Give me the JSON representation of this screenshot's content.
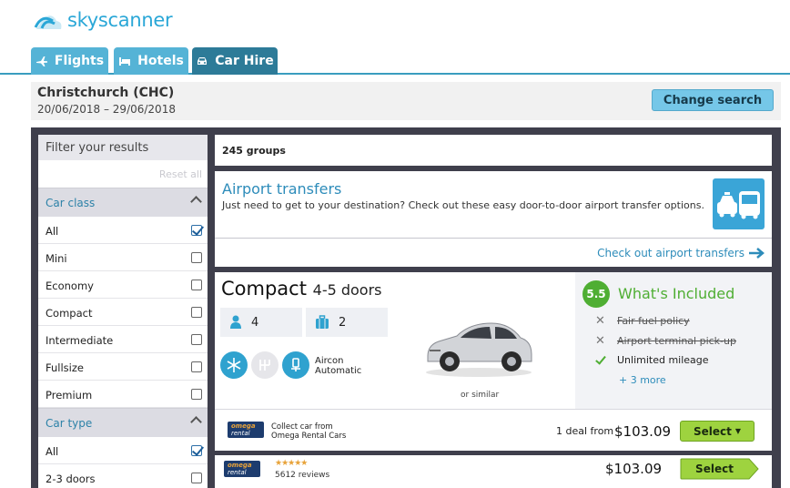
{
  "brand": {
    "name": "skyscanner",
    "color": "#2aa7d7"
  },
  "tabs": [
    {
      "label": "Flights",
      "icon": "plane-icon"
    },
    {
      "label": "Hotels",
      "icon": "bed-icon"
    },
    {
      "label": "Car Hire",
      "icon": "car-icon",
      "active": true
    }
  ],
  "search": {
    "location": "Christchurch (CHC)",
    "dates": "20/06/2018 – 29/06/2018",
    "change_label": "Change search"
  },
  "filters": {
    "title": "Filter your results",
    "reset_label": "Reset all",
    "car_class": {
      "heading": "Car class",
      "options": [
        {
          "label": "All",
          "checked": true
        },
        {
          "label": "Mini",
          "checked": false
        },
        {
          "label": "Economy",
          "checked": false
        },
        {
          "label": "Compact",
          "checked": false
        },
        {
          "label": "Intermediate",
          "checked": false
        },
        {
          "label": "Fullsize",
          "checked": false
        },
        {
          "label": "Premium",
          "checked": false
        }
      ]
    },
    "car_type": {
      "heading": "Car type",
      "options": [
        {
          "label": "All",
          "checked": true
        },
        {
          "label": "2-3 doors",
          "checked": false
        }
      ]
    }
  },
  "results": {
    "groups_count": "245 groups",
    "airport_transfers": {
      "title": "Airport transfers",
      "description": "Just need to get to your destination? Check out these easy door-to-door airport transfer options.",
      "link_label": "Check out airport transfers"
    },
    "car": {
      "class": "Compact",
      "doors": "4-5 doors",
      "seats": "4",
      "bags": "2",
      "feature_line1": "Aircon",
      "feature_line2": "Automatic",
      "similar_label": "or similar",
      "included": {
        "score": "5.5",
        "title": "What's Included",
        "items": [
          {
            "label": "Fair fuel policy",
            "included": false
          },
          {
            "label": "Airport terminal pick-up",
            "included": false
          },
          {
            "label": "Unlimited mileage",
            "included": true
          }
        ],
        "more_label": "+ 3 more"
      },
      "vendor_logo_line1": "omega",
      "vendor_logo_line2": "rental cars",
      "collect_line1": "Collect car from",
      "collect_line2": "Omega Rental Cars",
      "deal_label": "1 deal from",
      "price": "$103.09",
      "select_label": "Select"
    },
    "offer": {
      "stars": "★★★★★",
      "reviews": "5612 reviews",
      "price": "$103.09",
      "select_label": "Select"
    }
  }
}
